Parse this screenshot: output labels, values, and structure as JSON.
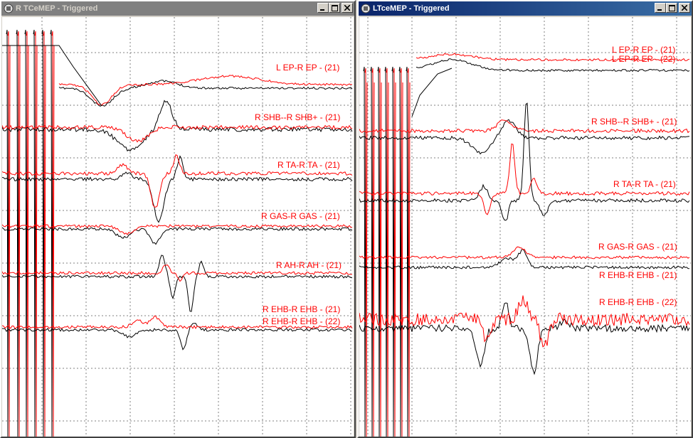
{
  "windows": {
    "left": {
      "title": "R TCeMEP - Triggered",
      "traces": [
        {
          "label": "L EP-R EP - (21)"
        },
        {
          "label": "R SHB--R SHB+ - (21)"
        },
        {
          "label": "R TA-R TA - (21)"
        },
        {
          "label": "R GAS-R GAS - (21)"
        },
        {
          "label": "R AH-R AH - (21)"
        },
        {
          "label": "R EHB-R EHB - (21)"
        },
        {
          "label": "R EHB-R EHB - (22)"
        }
      ]
    },
    "right": {
      "title": "LTceMEP - Triggered",
      "traces": [
        {
          "label": "L EP-R EP - (21)"
        },
        {
          "label": "L EP-R EP - (22)"
        },
        {
          "label": "R SHB--R SHB+ - (21)"
        },
        {
          "label": "R TA-R TA - (21)"
        },
        {
          "label": "R GAS-R GAS - (21)"
        },
        {
          "label": "R EHB-R EHB - (21)"
        },
        {
          "label": "R EHB-R EHB - (22)"
        }
      ]
    }
  },
  "colors": {
    "trace_red": "#ff0000",
    "trace_black": "#000000",
    "grid": "#808080",
    "active_title": "#0a246a",
    "inactive_title": "#808080"
  },
  "icons": {
    "app": "app-icon",
    "minimize": "minimize-icon",
    "maximize": "maximize-icon",
    "close": "close-icon"
  }
}
